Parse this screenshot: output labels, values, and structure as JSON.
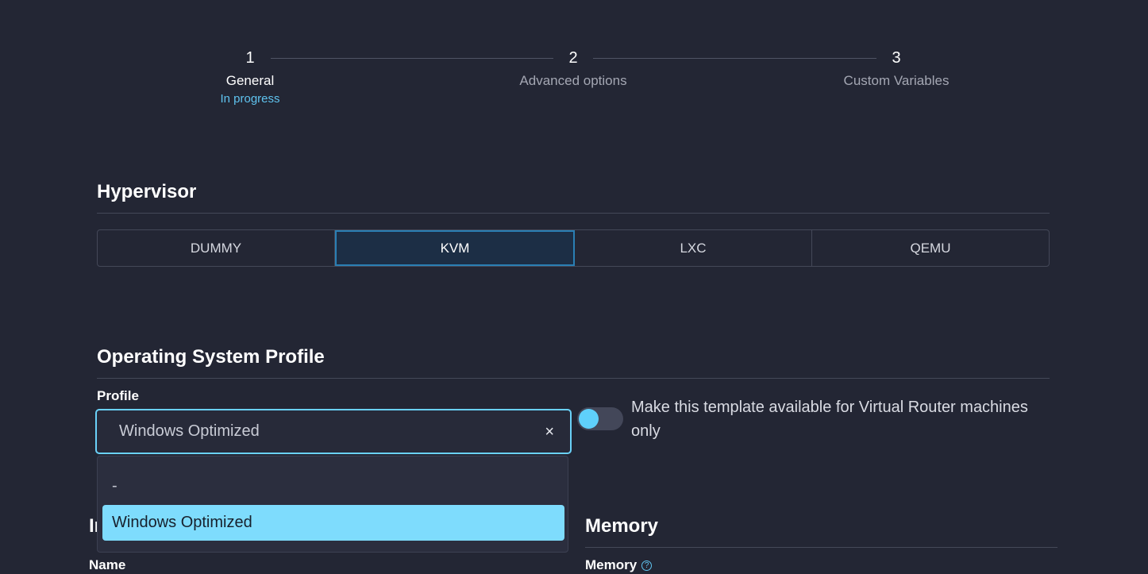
{
  "stepper": {
    "steps": [
      {
        "number": "1",
        "label": "General",
        "status": "In progress",
        "state": "active"
      },
      {
        "number": "2",
        "label": "Advanced options",
        "status": "",
        "state": "inactive"
      },
      {
        "number": "3",
        "label": "Custom Variables",
        "status": "",
        "state": "inactive"
      }
    ]
  },
  "hypervisor": {
    "title": "Hypervisor",
    "options": [
      "DUMMY",
      "KVM",
      "LXC",
      "QEMU"
    ],
    "selected": "KVM"
  },
  "os_profile": {
    "title": "Operating System Profile",
    "profile_label": "Profile",
    "profile_value": "Windows Optimized",
    "clear_glyph": "×",
    "toggle_label": "Make this template available for Virtual Router machines only",
    "toggle_on": false,
    "dropdown_options": [
      "-",
      "Windows Optimized"
    ],
    "highlighted_option": "Windows Optimized"
  },
  "information": {
    "title_partial": "In",
    "name_label": "Name"
  },
  "memory": {
    "title": "Memory",
    "memory_label": "Memory",
    "info_glyph": "?"
  },
  "colors": {
    "background": "#232634",
    "accent": "#5fc3ef",
    "selected_option": "#7edcfd",
    "selected_segment": "#1c2e45"
  }
}
